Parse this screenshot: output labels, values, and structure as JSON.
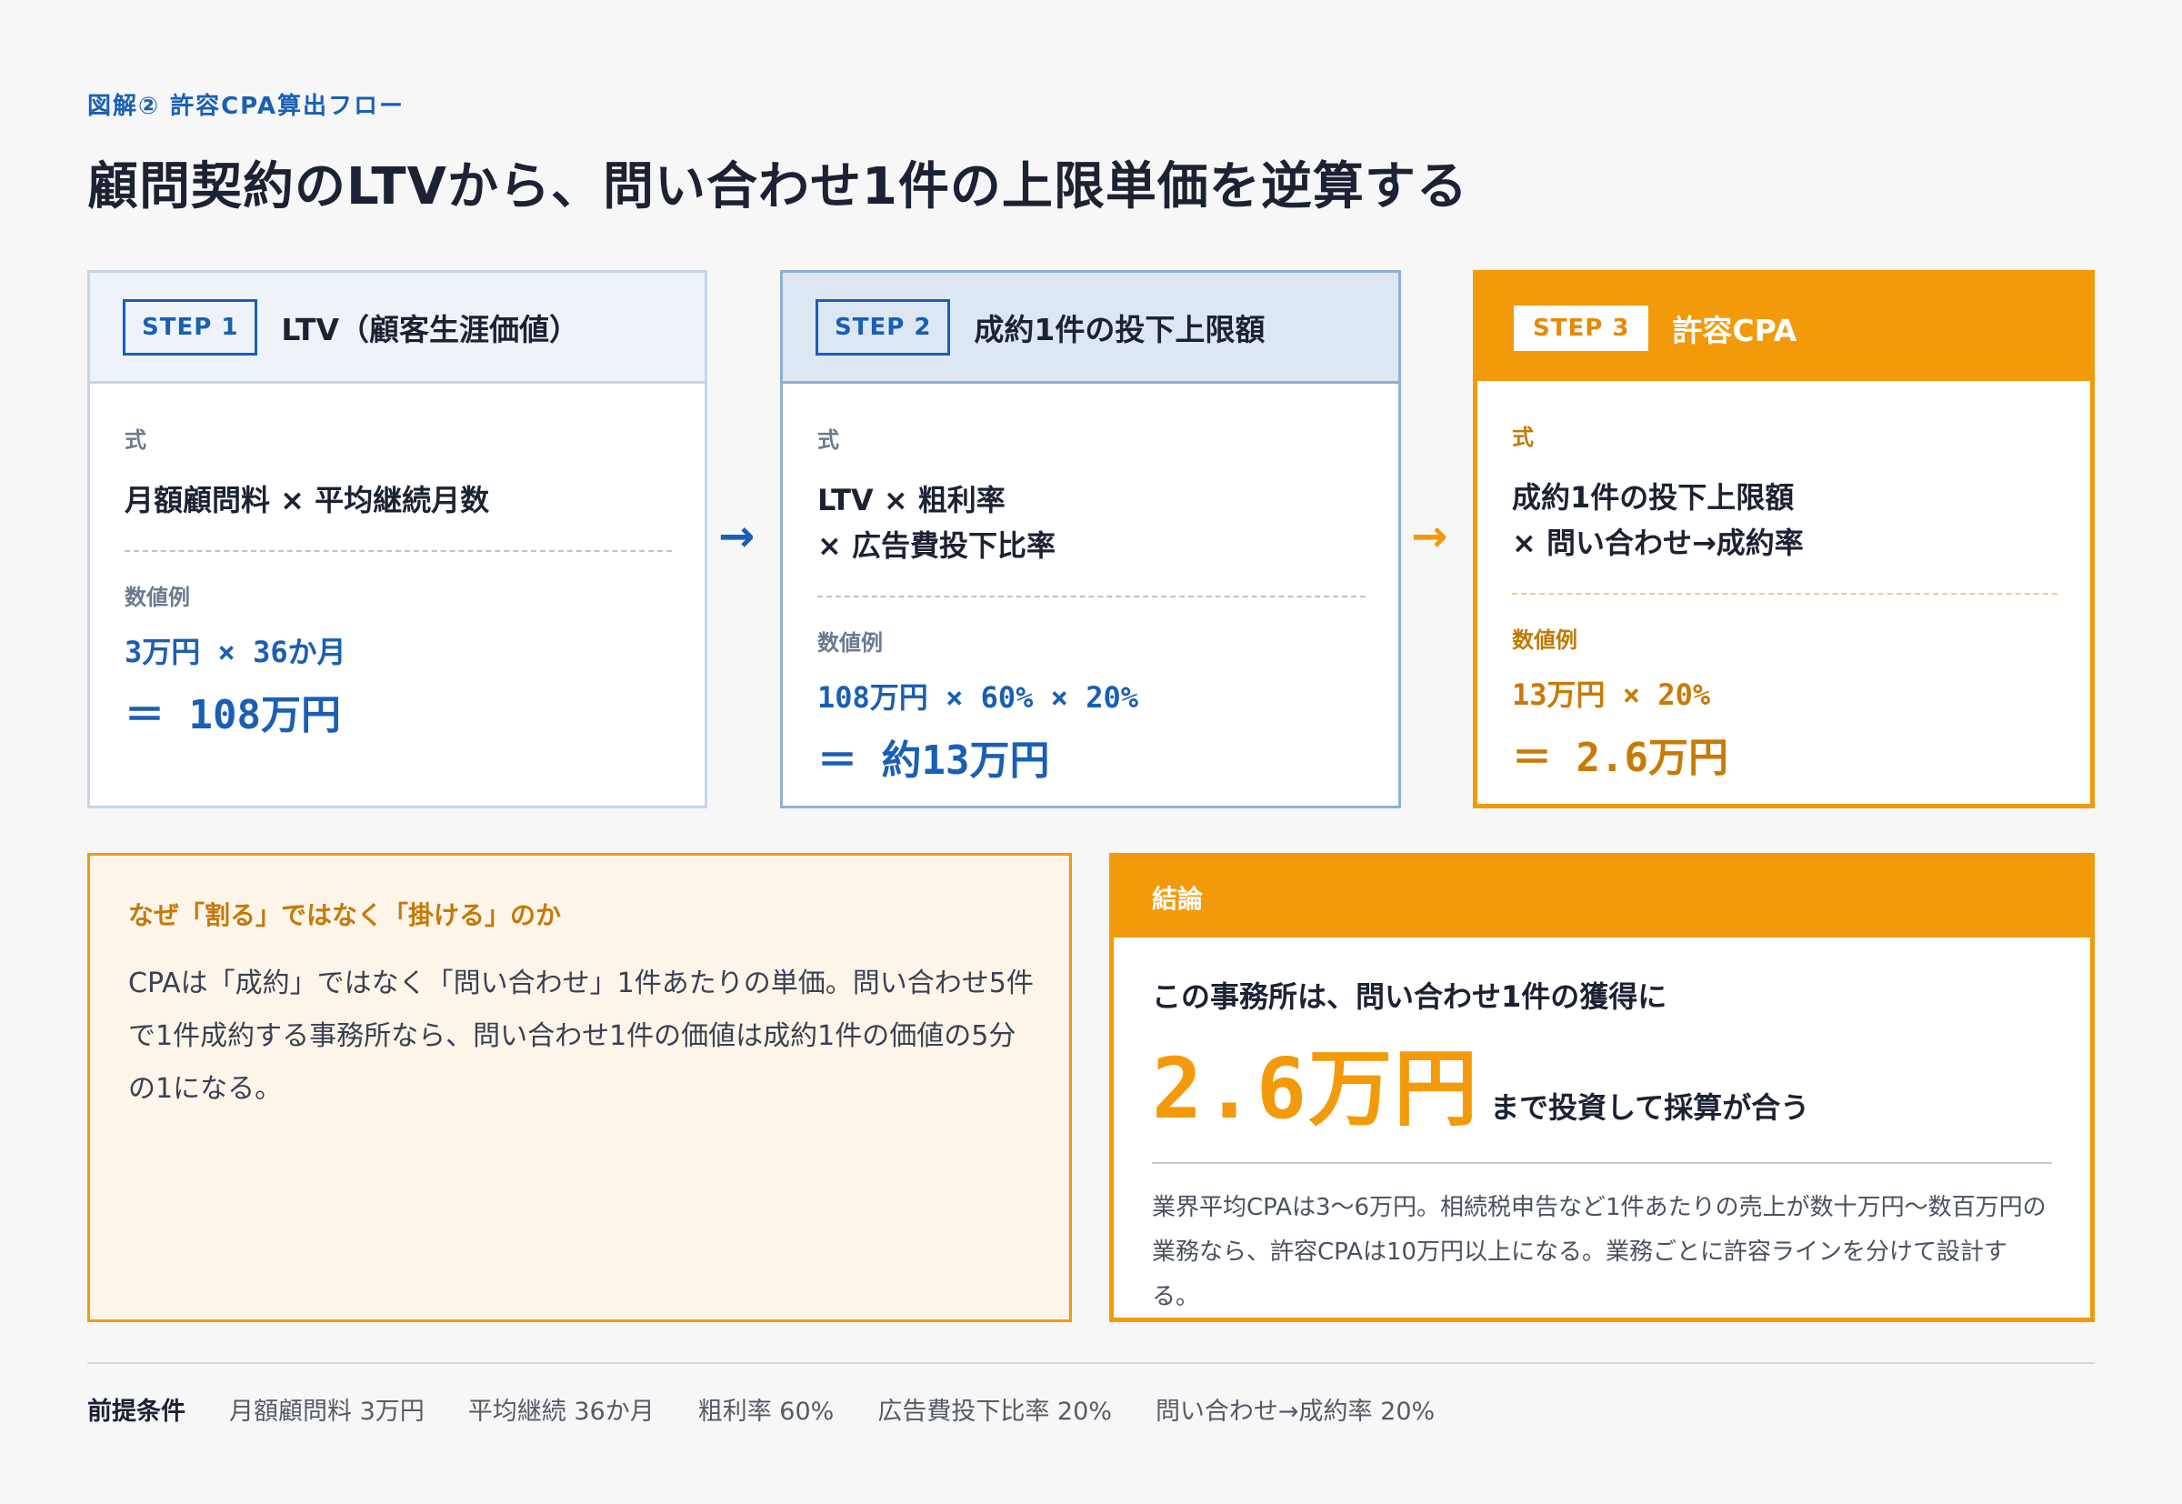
{
  "eyebrow": "図解② 許容CPA算出フロー",
  "title": "顧問契約のLTVから、問い合わせ1件の上限単価を逆算する",
  "steps": [
    {
      "badge": "STEP 1",
      "heading": "LTV（顧客生涯価値）",
      "formula_label": "式",
      "formula_lines": [
        "月額顧問料 × 平均継続月数"
      ],
      "example_label": "数値例",
      "example_lines": [
        "3万円 × 36か月"
      ],
      "result": "＝ 108万円"
    },
    {
      "badge": "STEP 2",
      "heading": "成約1件の投下上限額",
      "formula_label": "式",
      "formula_lines": [
        "LTV × 粗利率",
        "× 広告費投下比率"
      ],
      "example_label": "数値例",
      "example_lines": [
        "108万円 × 60% × 20%"
      ],
      "result": "＝ 約13万円"
    },
    {
      "badge": "STEP 3",
      "heading": "許容CPA",
      "formula_label": "式",
      "formula_lines": [
        "成約1件の投下上限額",
        "× 問い合わせ→成約率"
      ],
      "example_label": "数値例",
      "example_lines": [
        "13万円 × 20%"
      ],
      "result": "＝ 2.6万円"
    }
  ],
  "arrows": [
    "→",
    "→"
  ],
  "why": {
    "title": "なぜ「割る」ではなく「掛ける」のか",
    "text": "CPAは「成約」ではなく「問い合わせ」1件あたりの単価。問い合わせ5件で1件成約する事務所なら、問い合わせ1件の価値は成約1件の価値の5分の1になる。"
  },
  "conclusion": {
    "heading": "結論",
    "lead": "この事務所は、問い合わせ1件の獲得に",
    "big": "2.6万円",
    "after": "まで投資して採算が合う",
    "note": "業界平均CPAは3〜6万円。相続税申告など1件あたりの売上が数十万円〜数百万円の業務なら、許容CPAは10万円以上になる。業務ごとに許容ラインを分けて設計する。"
  },
  "footer": {
    "label": "前提条件",
    "items": [
      "月額顧問料 3万円",
      "平均継続 36か月",
      "粗利率 60%",
      "広告費投下比率 20%",
      "問い合わせ→成約率 20%"
    ]
  },
  "colors": {
    "blue": "#1a5fb4",
    "orange": "#f39a0a",
    "navy_text": "#1c2233"
  }
}
